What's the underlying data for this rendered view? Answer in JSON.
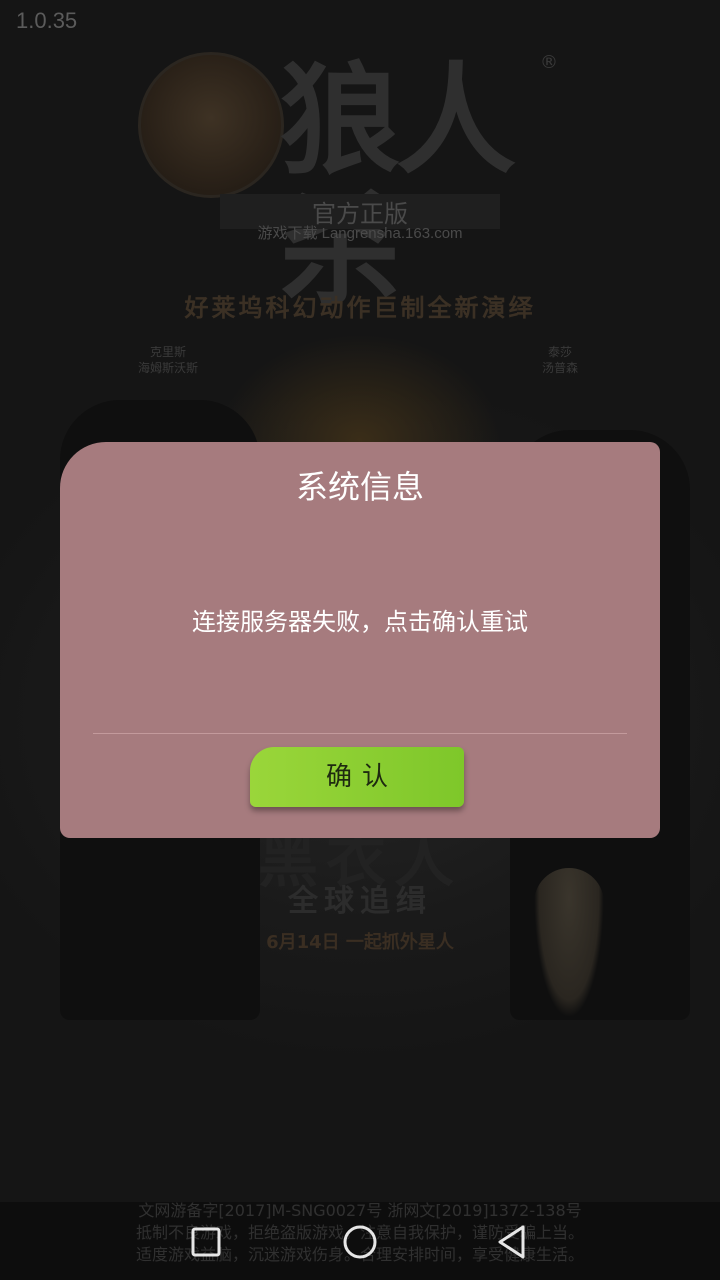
{
  "app": {
    "version": "1.0.35"
  },
  "splash": {
    "logo_title": "狼人杀",
    "logo_registered": "®",
    "logo_official": "官方正版",
    "logo_download": "游戏下载 Langrensha.163.com",
    "tagline": "好莱坞科幻动作巨制全新演绎",
    "actor_left": [
      "克里斯",
      "海姆斯沃斯"
    ],
    "actor_right": [
      "泰莎",
      "汤普森"
    ],
    "movie_title": "黑衣人",
    "movie_subtitle": "全球追缉",
    "release": "6月14日 一起抓外星人",
    "footer_notice": [
      "文网游备字[2017]M-SNG0027号 浙网文[2019]1372-138号",
      "抵制不良游戏，拒绝盗版游戏。注意自我保护，谨防受骗上当。",
      "适度游戏益脑，沉迷游戏伤身。合理安排时间，享受健康生活。"
    ]
  },
  "dialog": {
    "title": "系统信息",
    "message": "连接服务器失败，点击确认重试",
    "confirm_label": "确认",
    "background_color": "#a67b7e",
    "button_color": "#8fcf34"
  },
  "navbar": {
    "recent_icon": "square-recent-apps-icon",
    "home_icon": "circle-home-icon",
    "back_icon": "triangle-back-icon"
  }
}
